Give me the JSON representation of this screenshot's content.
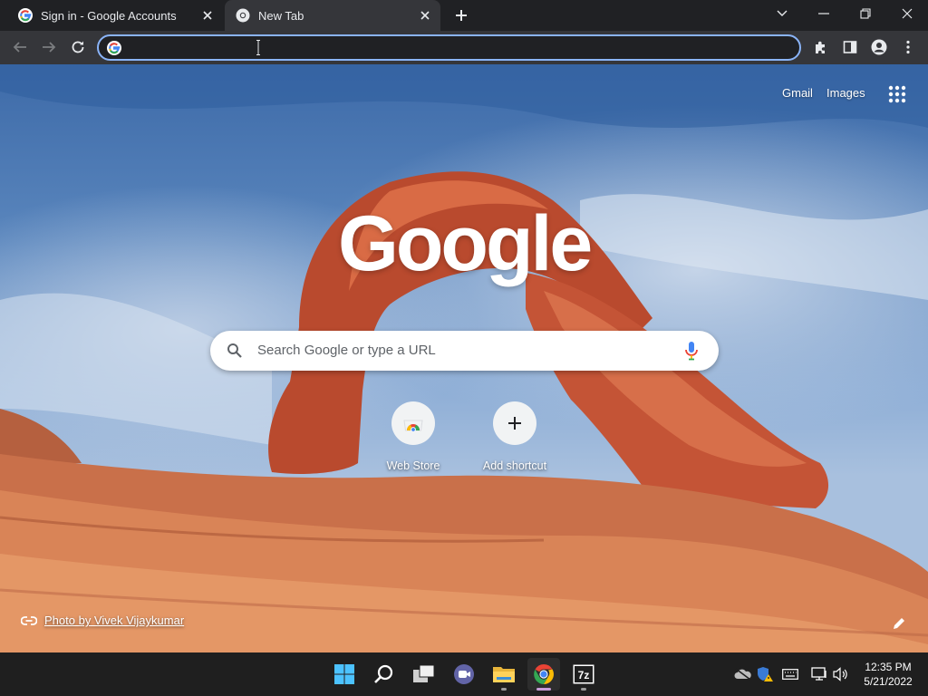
{
  "tabs": [
    {
      "title": "Sign in - Google Accounts",
      "active": false,
      "favicon": "google-g-icon"
    },
    {
      "title": "New Tab",
      "active": true,
      "favicon": "chrome-icon"
    }
  ],
  "window_controls": [
    "tab-search-chevron-icon",
    "minimize-icon",
    "restore-icon",
    "close-icon"
  ],
  "toolbar": {
    "omnibox_value": "",
    "omnibox_icon": "google-g-icon",
    "right_icons": [
      "extensions-icon",
      "side-panel-icon",
      "profile-icon",
      "menu-icon"
    ]
  },
  "ntp": {
    "links": {
      "gmail": "Gmail",
      "images": "Images"
    },
    "logo_text": "Google",
    "search_placeholder": "Search Google or type a URL",
    "shortcuts": [
      {
        "label": "Web Store",
        "icon": "web-store-icon"
      },
      {
        "label": "Add shortcut",
        "icon": "plus-icon"
      }
    ],
    "attribution": "Photo by Vivek Vijaykumar"
  },
  "taskbar": {
    "apps": [
      "windows-start-icon",
      "search-icon",
      "task-view-icon",
      "teams-chat-icon",
      "file-explorer-icon",
      "chrome-icon",
      "7zip-icon"
    ],
    "active_app": "chrome-icon",
    "seven_zip_label": "7z",
    "clock": {
      "time": "12:35 PM",
      "date": "5/21/2022"
    }
  },
  "colors": {
    "accent": "#8ab4f8",
    "tab_bg": "#35363a",
    "frame_bg": "#202124",
    "taskbar_bg": "#1f1f1f"
  }
}
